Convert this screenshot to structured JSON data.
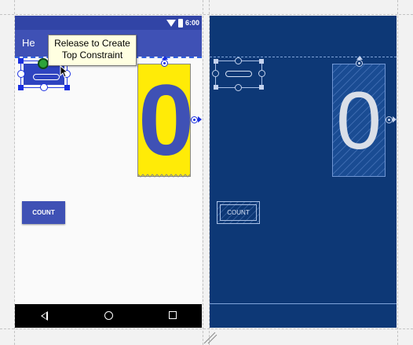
{
  "design": {
    "status_bar": {
      "time": "6:00"
    },
    "app_bar": {
      "title": "He"
    },
    "tooltip": {
      "line1": "Release to Create",
      "line2": "Top Constraint"
    },
    "counter": {
      "value": "0"
    },
    "button": {
      "label": "COUNT"
    }
  },
  "blueprint": {
    "counter": {
      "value": "0"
    },
    "button": {
      "label": "COUNT"
    }
  },
  "colors": {
    "primary": "#3f51b5",
    "primary_dark": "#3144a6",
    "counter_background": "#ffeb07",
    "selection": "#1a2fe0",
    "blueprint_background": "#0d3876",
    "canvas": "#f2f2f2"
  },
  "icons": {
    "status_bar": [
      "wifi-icon",
      "battery-icon"
    ],
    "navigation": [
      "back-icon",
      "home-icon",
      "recent-apps-icon"
    ],
    "cursor": "pointer-cursor-icon",
    "resize": "resize-grip-icon"
  }
}
